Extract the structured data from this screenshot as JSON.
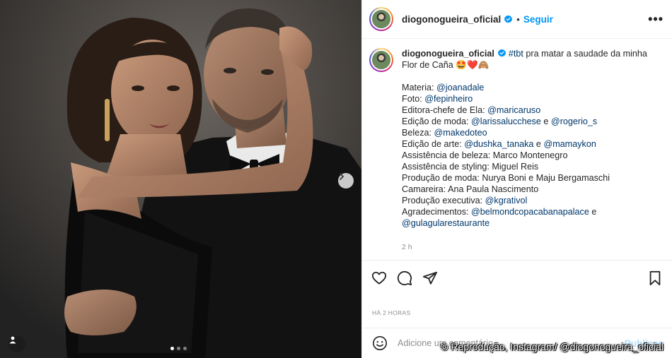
{
  "header": {
    "username": "diogonogueira_oficial",
    "separator": "•",
    "follow_label": "Seguir",
    "more_label": "•••",
    "verified_color": "#0095f6"
  },
  "caption": {
    "username": "diogonogueira_oficial",
    "hashtag": "#tbt",
    "text": " pra matar a saudade da minha Flor de Caña 🤩❤️🙈",
    "credits": [
      {
        "label": "Materia: ",
        "mention": "@joanadale"
      },
      {
        "label": "Foto: ",
        "mention": "@fepinheiro"
      },
      {
        "label": "Editora-chefe de Ela: ",
        "mention": "@maricaruso"
      },
      {
        "label": "Edição de moda: ",
        "mention": "@larissalucchese",
        "joiner": " e ",
        "mention2": "@rogerio_s"
      },
      {
        "label": "Beleza: ",
        "mention": "@makedoteo"
      },
      {
        "label": "Edição de arte: ",
        "mention": "@dushka_tanaka",
        "joiner": " e ",
        "mention2": "@mamaykon"
      },
      {
        "label": "Assistência de beleza: Marco Montenegro"
      },
      {
        "label": "Assistência de styling: Miguel Reis"
      },
      {
        "label": "Produção de moda: Nurya Boni e Maju Bergamaschi"
      },
      {
        "label": "Camareira: Ana Paula Nascimento"
      },
      {
        "label": "Produção executiva: ",
        "mention": "@kgrativol"
      },
      {
        "label": "Agradecimentos: ",
        "mention": "@belmondcopacabanapalace",
        "joiner": " e "
      },
      {
        "mention": "@gulagularestaurante"
      }
    ],
    "time": "2 h"
  },
  "actions": {
    "like_icon": "heart-icon",
    "comment_icon": "comment-icon",
    "share_icon": "paper-plane-icon",
    "save_icon": "bookmark-icon"
  },
  "timestamp_label": "HÁ 2 HORAS",
  "comment_box": {
    "placeholder": "Adicione um comentário...",
    "publish_label": "Publicar"
  },
  "carousel": {
    "active_index": 0,
    "count": 3
  },
  "watermark": "© Reprodução, Instagram/ @diogonogueira_oficial",
  "colors": {
    "accent": "#0095f6",
    "link": "#00376b",
    "muted": "#8e8e8e"
  }
}
